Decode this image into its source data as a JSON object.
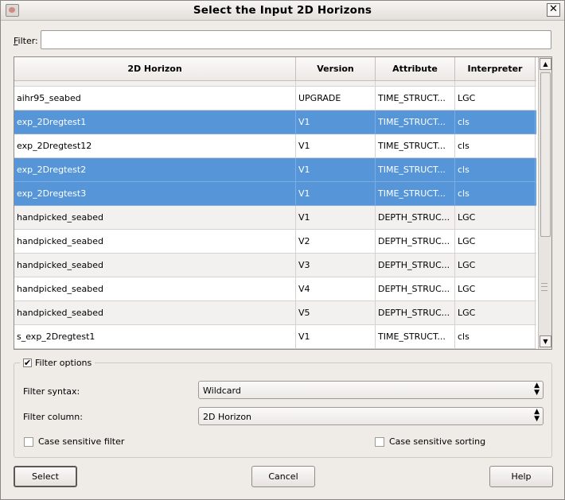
{
  "window": {
    "title": "Select the Input 2D Horizons"
  },
  "filter": {
    "label": "Filter:",
    "label_mnemonic": "F",
    "label_rest": "ilter:",
    "value": ""
  },
  "table": {
    "columns": [
      "2D Horizon",
      "Version",
      "Attribute",
      "Interpreter"
    ],
    "rows": [
      {
        "horizon": "aihr95_seabed",
        "version": "UPGRADE",
        "attribute": "TIME_STRUCT...",
        "interpreter": "LGC",
        "selected": false
      },
      {
        "horizon": "exp_2Dregtest1",
        "version": "V1",
        "attribute": "TIME_STRUCT...",
        "interpreter": "cls",
        "selected": true
      },
      {
        "horizon": "exp_2Dregtest12",
        "version": "V1",
        "attribute": "TIME_STRUCT...",
        "interpreter": "cls",
        "selected": false
      },
      {
        "horizon": "exp_2Dregtest2",
        "version": "V1",
        "attribute": "TIME_STRUCT...",
        "interpreter": "cls",
        "selected": true
      },
      {
        "horizon": "exp_2Dregtest3",
        "version": "V1",
        "attribute": "TIME_STRUCT...",
        "interpreter": "cls",
        "selected": true
      },
      {
        "horizon": "handpicked_seabed",
        "version": "V1",
        "attribute": "DEPTH_STRUC...",
        "interpreter": "LGC",
        "selected": false
      },
      {
        "horizon": "handpicked_seabed",
        "version": "V2",
        "attribute": "DEPTH_STRUC...",
        "interpreter": "LGC",
        "selected": false
      },
      {
        "horizon": "handpicked_seabed",
        "version": "V3",
        "attribute": "DEPTH_STRUC...",
        "interpreter": "LGC",
        "selected": false
      },
      {
        "horizon": "handpicked_seabed",
        "version": "V4",
        "attribute": "DEPTH_STRUC...",
        "interpreter": "LGC",
        "selected": false
      },
      {
        "horizon": "handpicked_seabed",
        "version": "V5",
        "attribute": "DEPTH_STRUC...",
        "interpreter": "LGC",
        "selected": false
      },
      {
        "horizon": "s_exp_2Dregtest1",
        "version": "V1",
        "attribute": "TIME_STRUCT...",
        "interpreter": "cls",
        "selected": false
      }
    ],
    "selection_color": "#5696d8"
  },
  "filter_options": {
    "label": "Filter options",
    "checked": true,
    "syntax_label": "Filter syntax:",
    "syntax_value": "Wildcard",
    "column_label": "Filter column:",
    "column_value": "2D Horizon",
    "case_filter_label": "Case sensitive filter",
    "case_filter_checked": false,
    "case_sorting_label": "Case sensitive sorting",
    "case_sorting_checked": false
  },
  "buttons": {
    "select": "Select",
    "cancel": "Cancel",
    "help": "Help"
  },
  "icons": {
    "app": "app-icon",
    "close": "close-icon",
    "check": "checkmark-icon",
    "updown": "updown-arrows-icon"
  }
}
